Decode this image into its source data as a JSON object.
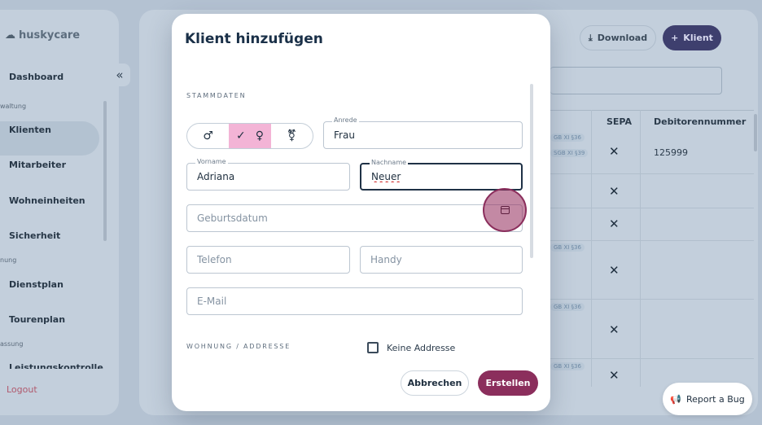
{
  "app": {
    "logo_text": "huskycare"
  },
  "sidebar": {
    "items": [
      {
        "label": "Dashboard"
      },
      {
        "label": "Klienten"
      },
      {
        "label": "Mitarbeiter"
      },
      {
        "label": "Wohneinheiten"
      },
      {
        "label": "Sicherheit"
      },
      {
        "label": "Dienstplan"
      },
      {
        "label": "Tourenplan"
      },
      {
        "label": "Leistungskontrolle"
      }
    ],
    "sections": [
      "waltung",
      "nung",
      "assung"
    ],
    "logout": "Logout"
  },
  "header": {
    "download_label": "Download",
    "add_label": "Klient"
  },
  "table": {
    "columns": [
      "SEPA",
      "Debitorennummer"
    ],
    "debitor_first": "125999",
    "tags": [
      "GB XI §36",
      "SGB XI §39",
      "GB XI §36",
      "GB XI §36",
      "GB XI §36"
    ]
  },
  "bug_button": {
    "label": "Report a Bug"
  },
  "modal": {
    "title": "Klient hinzufügen",
    "section_stammdaten": "STAMMDATEN",
    "gender_male": "♂",
    "gender_female": "♀",
    "gender_diverse": "⚧",
    "gender_check": "✓",
    "anrede": {
      "label": "Anrede",
      "value": "Frau"
    },
    "vorname": {
      "label": "Vorname",
      "value": "Adriana"
    },
    "nachname": {
      "label": "Nachname",
      "value": "Neuer"
    },
    "geburtsdatum": {
      "placeholder": "Geburtsdatum"
    },
    "telefon": {
      "placeholder": "Telefon"
    },
    "handy": {
      "placeholder": "Handy"
    },
    "email": {
      "placeholder": "E-Mail"
    },
    "section_wohnung": "WOHNUNG / ADDRESSE",
    "keine_addresse": "Keine Addresse",
    "cancel_label": "Abbrechen",
    "create_label": "Erstellen"
  }
}
